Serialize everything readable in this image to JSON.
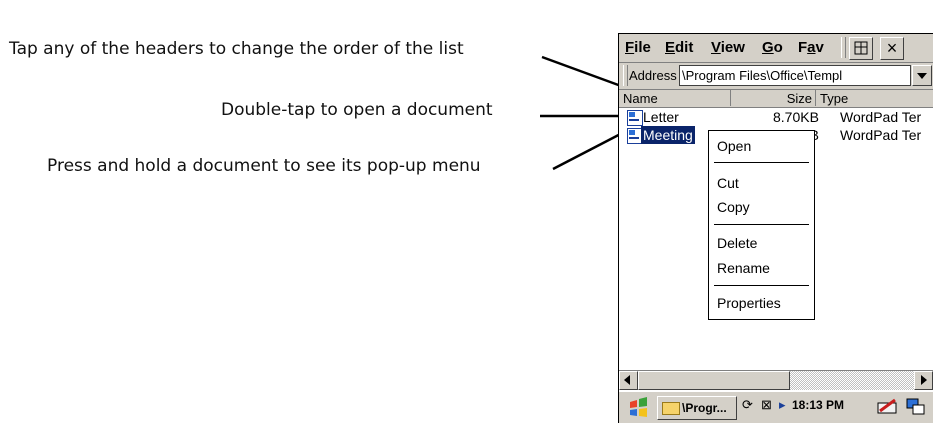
{
  "callouts": {
    "headers": "Tap any of the headers to change the order of the list",
    "double_tap": "Double-tap to open a document",
    "press_hold": "Press and hold a document to see its pop-up menu"
  },
  "menubar": {
    "file": {
      "ul": "F",
      "rest": "ile"
    },
    "edit": {
      "ul": "E",
      "rest": "dit"
    },
    "view": {
      "ul": "V",
      "rest": "iew"
    },
    "go": {
      "ul": "G",
      "rest": "o"
    },
    "favorites": {
      "pre": "F",
      "ul": "a",
      "rest": "v"
    },
    "close": "×"
  },
  "address": {
    "label": "Address",
    "value": "\\Program Files\\Office\\Templ"
  },
  "list": {
    "headers": [
      "Name",
      "Size",
      "Type"
    ],
    "rows": [
      {
        "name": "Letter",
        "size": "8.70KB",
        "type": "WordPad Ter"
      },
      {
        "name": "Meeting",
        "size": "8.56KB",
        "type": "WordPad Ter"
      }
    ]
  },
  "context_menu": {
    "open": "Open",
    "cut": "Cut",
    "copy": "Copy",
    "delete": "Delete",
    "rename": "Rename",
    "properties": "Properties"
  },
  "taskbar": {
    "task_label": "\\Progr...",
    "clock": "18:13 PM",
    "sync_glyph": "⟳",
    "connection_glyph": "⊠",
    "arrow_glyph": "▸"
  },
  "colors": {
    "selection": "#0a246a",
    "chrome": "#d4d0c8"
  }
}
